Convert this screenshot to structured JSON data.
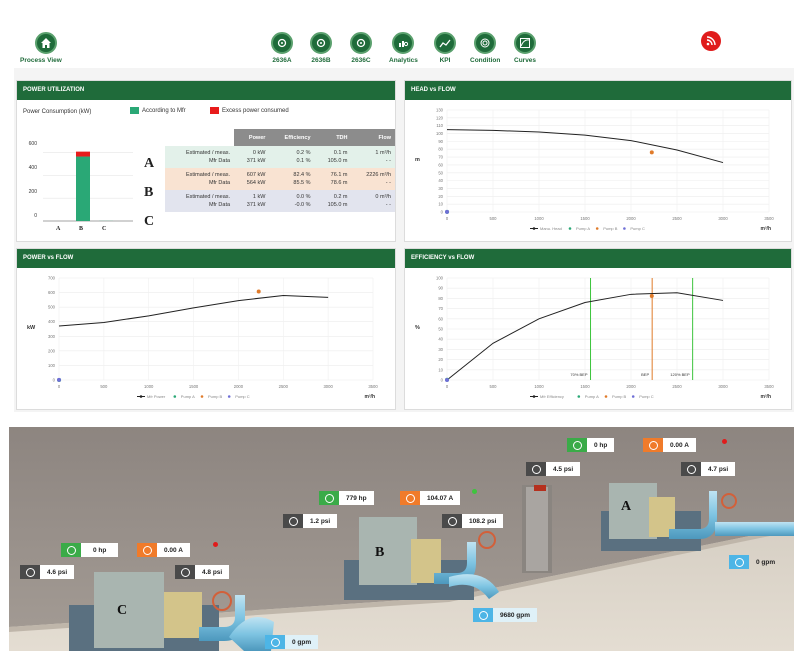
{
  "nav": {
    "process_view": "Process View",
    "items": [
      "2636A",
      "2636B",
      "2636C",
      "Analytics",
      "KPI",
      "Condition",
      "Curves"
    ]
  },
  "power_utilization": {
    "title": "POWER UTILIZATION",
    "subtitle": "Power Consumption (kW)",
    "legend_ok": "According to Mfr",
    "legend_excess": "Excess power consumed",
    "columns": [
      "Power",
      "Efficiency",
      "TDH",
      "Flow"
    ],
    "rows": [
      {
        "pump": "A",
        "estimated_label": "Estimated / meas.",
        "mfr_label": "Mfr Data",
        "est": [
          "0 kW",
          "0.2 %",
          "0.1 m",
          "1 m³/h"
        ],
        "mfr": [
          "371 kW",
          "0.1 %",
          "105.0 m",
          "- -"
        ]
      },
      {
        "pump": "B",
        "estimated_label": "Estimated / meas.",
        "mfr_label": "Mfr Data",
        "est": [
          "607 kW",
          "82.4 %",
          "76.1 m",
          "2226 m³/h"
        ],
        "mfr": [
          "564 kW",
          "85.5 %",
          "78.6 m",
          "- -"
        ]
      },
      {
        "pump": "C",
        "estimated_label": "Estimated / meas.",
        "mfr_label": "Mfr Data",
        "est": [
          "1 kW",
          "0.0 %",
          "0.2 m",
          "0 m³/h"
        ],
        "mfr": [
          "371 kW",
          "-0.0 %",
          "105.0 m",
          "- -"
        ]
      }
    ]
  },
  "head_vs_flow": {
    "title": "HEAD vs FLOW"
  },
  "power_vs_flow": {
    "title": "POWER vs FLOW"
  },
  "efficiency_vs_flow": {
    "title": "EFFICIENCY vs FLOW"
  },
  "chart_data": [
    {
      "type": "bar",
      "title": "Power Consumption (kW)",
      "categories": [
        "A",
        "B",
        "C"
      ],
      "series": [
        {
          "name": "According to Mfr",
          "values": [
            0,
            564,
            1
          ]
        },
        {
          "name": "Excess power consumed",
          "values": [
            0,
            43,
            0
          ]
        }
      ],
      "ylim": [
        0,
        700
      ],
      "yticks": [
        "0",
        "200",
        "400",
        "600"
      ]
    },
    {
      "type": "line",
      "title": "HEAD vs FLOW",
      "xlabel": "m³/h",
      "ylabel": "m",
      "xlim": [
        0,
        3500
      ],
      "ylim": [
        0,
        130
      ],
      "xticks": [
        "0",
        "500",
        "1000",
        "1500",
        "2000",
        "2500",
        "3000",
        "3500"
      ],
      "yticks": [
        "0",
        "10",
        "20",
        "30",
        "40",
        "50",
        "60",
        "70",
        "80",
        "90",
        "100",
        "110",
        "120",
        "130"
      ],
      "series": [
        {
          "name": "Manu. Head",
          "x": [
            0,
            500,
            1000,
            1500,
            2000,
            2500,
            3000
          ],
          "y": [
            105,
            104,
            102,
            98,
            91,
            79,
            63
          ]
        },
        {
          "name": "Pump A",
          "x": [
            1
          ],
          "y": [
            0.1
          ]
        },
        {
          "name": "Pump B",
          "x": [
            2226
          ],
          "y": [
            76
          ]
        },
        {
          "name": "Pump C",
          "x": [
            0
          ],
          "y": [
            0.2
          ]
        }
      ],
      "legend": [
        "Manu. Head",
        "Pump A",
        "Pump B",
        "Pump C"
      ],
      "colors": {
        "curve": "#222222",
        "pump_a": "#2aa876",
        "pump_b": "#e07b2a",
        "pump_c": "#6f6fd6"
      }
    },
    {
      "type": "line",
      "title": "POWER vs FLOW",
      "xlabel": "m³/h",
      "ylabel": "kW",
      "xlim": [
        0,
        3500
      ],
      "ylim": [
        0,
        700
      ],
      "xticks": [
        "0",
        "500",
        "1000",
        "1500",
        "2000",
        "2500",
        "3000",
        "3500"
      ],
      "yticks": [
        "0",
        "100",
        "200",
        "300",
        "400",
        "500",
        "600",
        "700"
      ],
      "series": [
        {
          "name": "Mfr Power",
          "x": [
            0,
            500,
            1000,
            1500,
            2000,
            2500,
            3000
          ],
          "y": [
            371,
            395,
            440,
            495,
            545,
            580,
            567
          ]
        },
        {
          "name": "Pump A",
          "x": [
            1
          ],
          "y": [
            0
          ]
        },
        {
          "name": "Pump B",
          "x": [
            2226
          ],
          "y": [
            607
          ]
        },
        {
          "name": "Pump C",
          "x": [
            0
          ],
          "y": [
            1
          ]
        }
      ],
      "legend": [
        "Mfr Power",
        "Pump A",
        "Pump B",
        "Pump C"
      ]
    },
    {
      "type": "line",
      "title": "EFFICIENCY vs FLOW",
      "xlabel": "m³/h",
      "ylabel": "%",
      "xlim": [
        0,
        3500
      ],
      "ylim": [
        0,
        100
      ],
      "xticks": [
        "0",
        "500",
        "1000",
        "1500",
        "2000",
        "2500",
        "3000",
        "3500"
      ],
      "yticks": [
        "0",
        "10",
        "20",
        "30",
        "40",
        "50",
        "60",
        "70",
        "80",
        "90",
        "100"
      ],
      "series": [
        {
          "name": "Mfr Efficiency",
          "x": [
            0,
            500,
            1000,
            1500,
            2000,
            2500,
            3000
          ],
          "y": [
            0,
            36,
            60,
            76,
            84,
            85.5,
            78
          ]
        },
        {
          "name": "Pump A",
          "x": [
            1
          ],
          "y": [
            0.2
          ]
        },
        {
          "name": "Pump B",
          "x": [
            2226
          ],
          "y": [
            82.4
          ]
        },
        {
          "name": "Pump C",
          "x": [
            0
          ],
          "y": [
            0
          ]
        }
      ],
      "bep_lines": [
        {
          "label": "70% BEP",
          "x": 1560,
          "color": "#3cc43c"
        },
        {
          "label": "BEP",
          "x": 2230,
          "color": "#e07b2a"
        },
        {
          "label": "120% BEP",
          "x": 2670,
          "color": "#3cc43c"
        }
      ],
      "legend": [
        "Mfr Efficiency",
        "Pump A",
        "Pump B",
        "Pump C"
      ]
    }
  ],
  "scene": {
    "pump_a": {
      "power": "0 hp",
      "current": "0.00 A",
      "suction": "4.5 psi",
      "discharge": "4.7 psi",
      "flow": "0 gpm",
      "letter": "A",
      "status_color": "#e01c1c"
    },
    "pump_b": {
      "power": "779 hp",
      "current": "104.07 A",
      "suction": "1.2 psi",
      "discharge": "108.2 psi",
      "flow": "9680 gpm",
      "letter": "B",
      "status_color": "#3ec43e"
    },
    "pump_c": {
      "power": "0 hp",
      "current": "0.00 A",
      "suction": "4.6 psi",
      "discharge": "4.8 psi",
      "flow": "0 gpm",
      "letter": "C",
      "status_color": "#e01c1c"
    }
  }
}
